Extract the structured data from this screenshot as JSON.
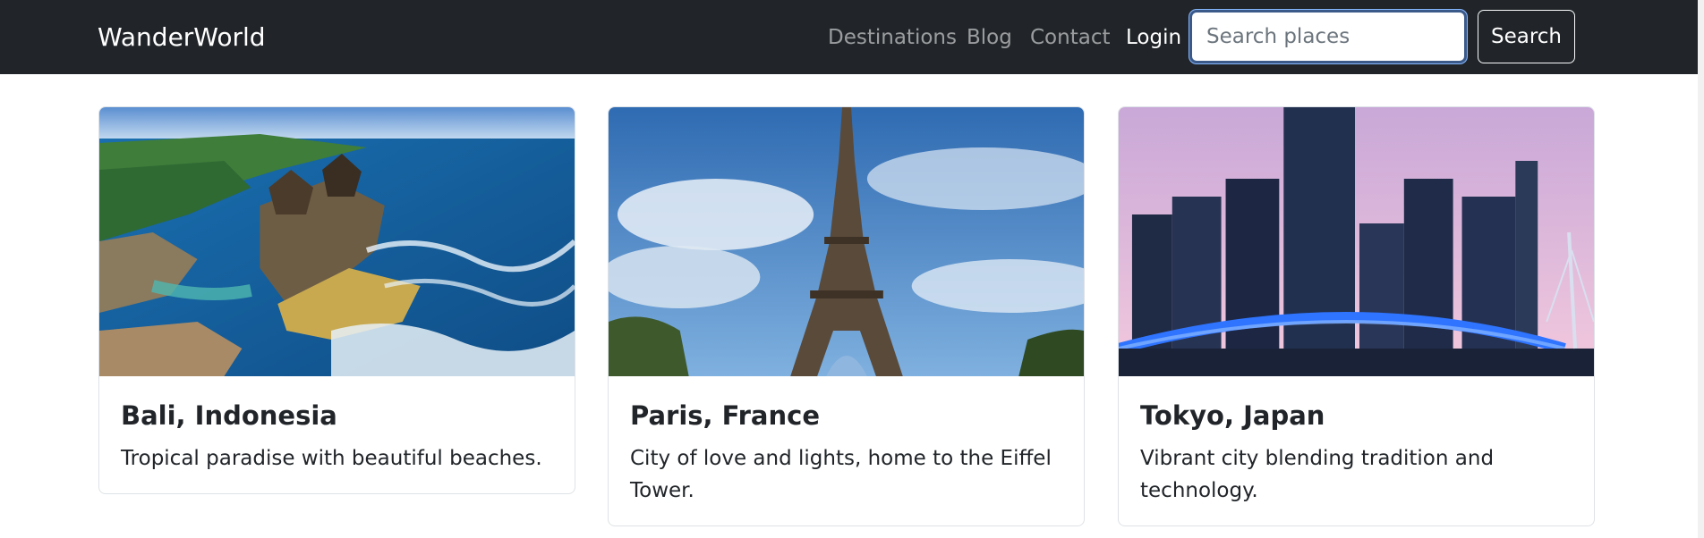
{
  "navbar": {
    "brand": "WanderWorld",
    "links": [
      {
        "label": "Destinations"
      },
      {
        "label": "Blog"
      },
      {
        "label": "Contact"
      },
      {
        "label": "Login"
      }
    ],
    "search": {
      "placeholder": "Search places",
      "value": "",
      "button_label": "Search"
    }
  },
  "cards": [
    {
      "title": "Bali, Indonesia",
      "text": "Tropical paradise with beautiful beaches.",
      "image_icon": "bali-temple-coast-image"
    },
    {
      "title": "Paris, France",
      "text": "City of love and lights, home to the Eiffel Tower.",
      "image_icon": "eiffel-tower-image"
    },
    {
      "title": "Tokyo, Japan",
      "text": "Vibrant city blending tradition and technology.",
      "image_icon": "tokyo-skyline-bridge-image"
    }
  ],
  "colors": {
    "navbar_bg": "#212529",
    "nav_link_muted": "#8c8f93",
    "nav_link_active": "#ffffff",
    "search_focus_border": "#3b5a8a",
    "card_border": "#dee2e6"
  }
}
